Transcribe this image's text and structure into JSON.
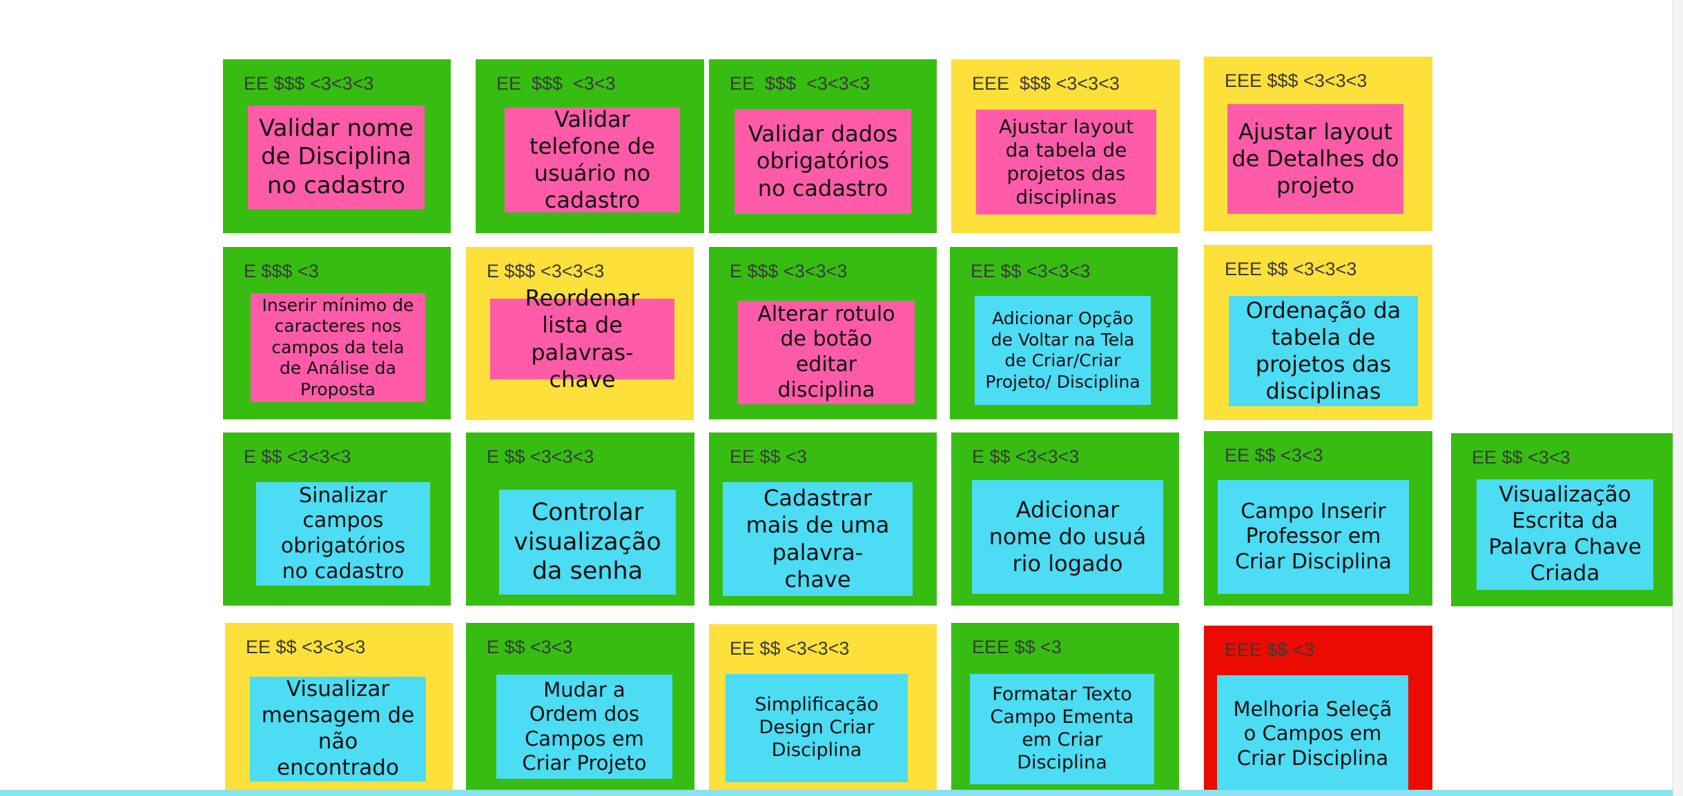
{
  "colors": {
    "green": "#37bd12",
    "yellow": "#fde03a",
    "red": "#ec0b00",
    "pink": "#ff5ba8",
    "cyan": "#4cdcf3",
    "bottom_strip": "#8be3ef"
  },
  "cards": [
    {
      "bg": "green",
      "note": "pink",
      "header": "EE $$$ <3<3<3",
      "text": "Validar nome\nde Disciplina\nno cadastro"
    },
    {
      "bg": "green",
      "note": "pink",
      "header": "EE  $$$  <3<3",
      "text": "Validar\ntelefone de\nusuário no\ncadastro"
    },
    {
      "bg": "green",
      "note": "pink",
      "header": "EE  $$$  <3<3<3",
      "text": "Validar dados\nobrigatórios\nno cadastro"
    },
    {
      "bg": "yellow",
      "note": "pink",
      "header": "EEE  $$$ <3<3<3",
      "text": "Ajustar layout\nda tabela de\nprojetos das\ndisciplinas"
    },
    {
      "bg": "yellow",
      "note": "pink",
      "header": "EEE $$$ <3<3<3",
      "text": "Ajustar layout\nde Detalhes do\nprojeto"
    },
    {
      "bg": "green",
      "note": "pink",
      "header": "E $$$ <3",
      "text": "Inserir mínimo de\ncaracteres nos\ncampos da tela\nde Análise da\nProposta"
    },
    {
      "bg": "yellow",
      "note": "pink",
      "header": "E $$$ <3<3<3",
      "text": "Reordenar\nlista de\npalavras-\nchave"
    },
    {
      "bg": "green",
      "note": "pink",
      "header": "E $$$ <3<3<3",
      "text": "Alterar rotulo\nde botão\neditar\ndisciplina"
    },
    {
      "bg": "green",
      "note": "cyan",
      "header": "EE $$ <3<3<3",
      "text": "Adicionar Opção\nde Voltar na Tela\nde Criar/Criar\nProjeto/ Disciplina"
    },
    {
      "bg": "yellow",
      "note": "cyan",
      "header": "EEE $$ <3<3<3",
      "text": "Ordenação da\ntabela de\nprojetos das\ndisciplinas"
    },
    {
      "bg": "green",
      "note": "cyan",
      "header": "E $$ <3<3<3",
      "text": "Sinalizar\ncampos\nobrigatórios\nno cadastro"
    },
    {
      "bg": "green",
      "note": "cyan",
      "header": "E $$ <3<3<3",
      "text": "Controlar\nvisualização\nda senha"
    },
    {
      "bg": "green",
      "note": "cyan",
      "header": "EE $$ <3",
      "text": "Cadastrar\nmais de uma\npalavra-\nchave"
    },
    {
      "bg": "green",
      "note": "cyan",
      "header": "E $$ <3<3<3",
      "text": "Adicionar\nnome do usuá\nrio logado"
    },
    {
      "bg": "green",
      "note": "cyan",
      "header": "EE $$ <3<3",
      "text": "Campo Inserir\nProfessor em\nCriar Disciplina"
    },
    {
      "bg": "green",
      "note": "cyan",
      "header": "EE $$ <3<3",
      "text": "Visualização\nEscrita da\nPalavra Chave\nCriada"
    },
    {
      "bg": "yellow",
      "note": "cyan",
      "header": "EE $$ <3<3<3",
      "text": "Visualizar\nmensagem de\nnão\nencontrado"
    },
    {
      "bg": "green",
      "note": "cyan",
      "header": "E $$ <3<3",
      "text": "Mudar a\nOrdem dos\nCampos em\nCriar Projeto"
    },
    {
      "bg": "yellow",
      "note": "cyan",
      "header": "EE $$ <3<3<3",
      "text": "Simplificação\nDesign Criar\nDisciplina"
    },
    {
      "bg": "green",
      "note": "cyan",
      "header": "EEE $$ <3",
      "text": "Formatar Texto\nCampo Ementa\nem Criar\nDisciplina"
    },
    {
      "bg": "red",
      "note": "cyan",
      "header": "EEE $$ <3",
      "text": "Melhoria Seleçã\no Campos em\nCriar Disciplina"
    }
  ]
}
